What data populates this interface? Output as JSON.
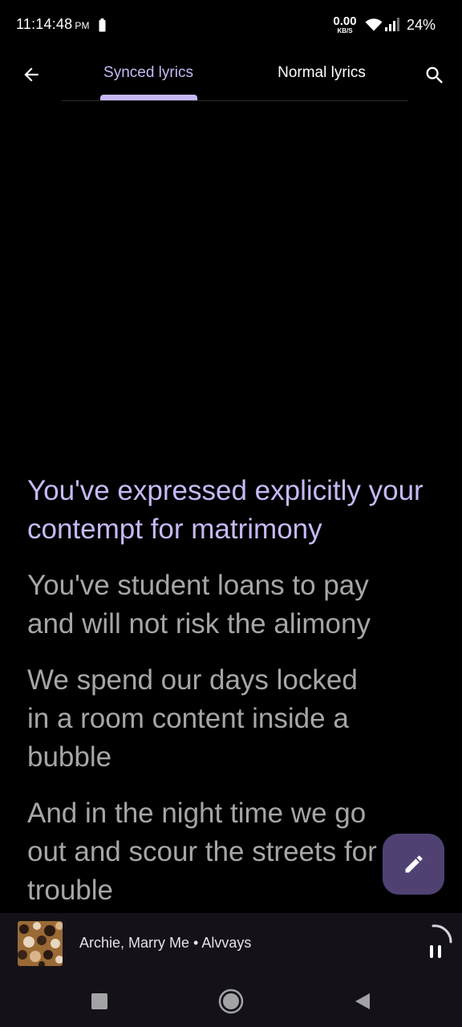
{
  "status_bar": {
    "time": "11:14:48",
    "ampm": "PM",
    "net_speed": "0.00",
    "net_unit": "KB/S",
    "battery": "24%"
  },
  "header": {
    "tabs": [
      {
        "label": "Synced lyrics",
        "active": true
      },
      {
        "label": "Normal lyrics",
        "active": false
      }
    ],
    "back_icon": "arrow-left-icon",
    "search_icon": "search-icon"
  },
  "lyrics": [
    {
      "text": "You've expressed explicitly your contempt for matrimony",
      "current": true
    },
    {
      "text": "You've student loans to pay and will not risk the alimony",
      "current": false
    },
    {
      "text": "We spend our days locked in a room content inside a bubble",
      "current": false
    },
    {
      "text": "And in the night time we go out and scour the streets for trouble",
      "current": false
    }
  ],
  "fab": {
    "icon": "pencil-icon"
  },
  "mini_player": {
    "track_info": "Archie, Marry Me • Alvvays",
    "play_state_icon": "pause-icon"
  },
  "colors": {
    "background": "#000000",
    "accent": "#c7b8f5",
    "lyric_inactive": "#a6a6a6",
    "fab_bg": "#4f4273",
    "player_bg": "#141218"
  }
}
